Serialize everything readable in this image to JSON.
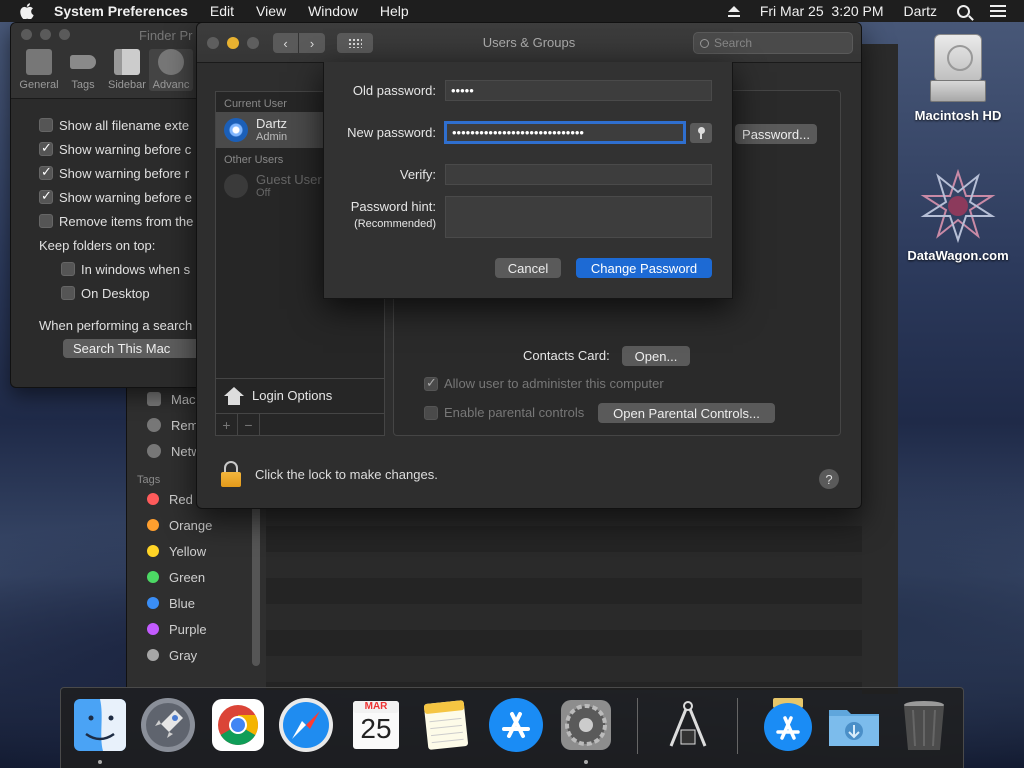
{
  "menubar": {
    "app_name": "System Preferences",
    "menus": [
      "Edit",
      "View",
      "Window",
      "Help"
    ],
    "datetime": "Fri Mar 25  3:20 PM",
    "user": "Dartz"
  },
  "finder_prefs": {
    "title": "Finder Pr",
    "tabs": [
      "General",
      "Tags",
      "Sidebar",
      "Advanc"
    ],
    "options": [
      {
        "label": "Show all filename exte",
        "checked": false
      },
      {
        "label": "Show warning before c",
        "checked": true
      },
      {
        "label": "Show warning before r",
        "checked": true
      },
      {
        "label": "Show warning before e",
        "checked": true
      },
      {
        "label": "Remove items from the",
        "checked": false
      }
    ],
    "keep_folders_label": "Keep folders on top:",
    "keep_options": [
      {
        "label": "In windows when s",
        "checked": false
      },
      {
        "label": "On Desktop",
        "checked": false
      }
    ],
    "search_label": "When performing a search",
    "search_value": "Search This Mac"
  },
  "finder_sidebar": {
    "items": [
      "Mac",
      "Rem",
      "Netw"
    ],
    "tags_header": "Tags",
    "tags": [
      {
        "name": "Red",
        "color": "#ff5b5b"
      },
      {
        "name": "Orange",
        "color": "#ff9f2e"
      },
      {
        "name": "Yellow",
        "color": "#ffd426"
      },
      {
        "name": "Green",
        "color": "#4cd964"
      },
      {
        "name": "Blue",
        "color": "#3a8ef6"
      },
      {
        "name": "Purple",
        "color": "#c35bff"
      },
      {
        "name": "Gray",
        "color": "#a6a6a6"
      }
    ]
  },
  "users_groups": {
    "title": "Users & Groups",
    "search_placeholder": "Search",
    "current_user_header": "Current User",
    "current_user": {
      "name": "Dartz",
      "role": "Admin"
    },
    "other_users_header": "Other Users",
    "guest_user": {
      "name": "Guest User",
      "status": "Off"
    },
    "login_options": "Login Options",
    "change_password_button": "Password...",
    "contacts_card_label": "Contacts Card:",
    "open_button": "Open...",
    "allow_admin_label": "Allow user to administer this computer",
    "allow_admin_checked": true,
    "parental_label": "Enable parental controls",
    "parental_checked": false,
    "open_parental_button": "Open Parental Controls...",
    "lock_text": "Click the lock to make changes.",
    "help": "?"
  },
  "password_sheet": {
    "old_label": "Old password:",
    "old_value": "•••••",
    "new_label": "New password:",
    "new_value": "•••••••••••••••••••••••••••••",
    "verify_label": "Verify:",
    "verify_value": "",
    "hint_label": "Password hint:",
    "hint_sublabel": "(Recommended)",
    "cancel": "Cancel",
    "change": "Change Password"
  },
  "desktop": {
    "icons": [
      "Macintosh HD",
      "DataWagon.com"
    ]
  },
  "dock": {
    "calendar_month": "MAR",
    "calendar_day": "25",
    "apps": [
      "Finder",
      "Launchpad",
      "Chrome",
      "Safari",
      "Calendar",
      "Notes",
      "App Store",
      "System Preferences",
      "Utility",
      "App Store Downloads",
      "Downloads",
      "Trash"
    ]
  }
}
